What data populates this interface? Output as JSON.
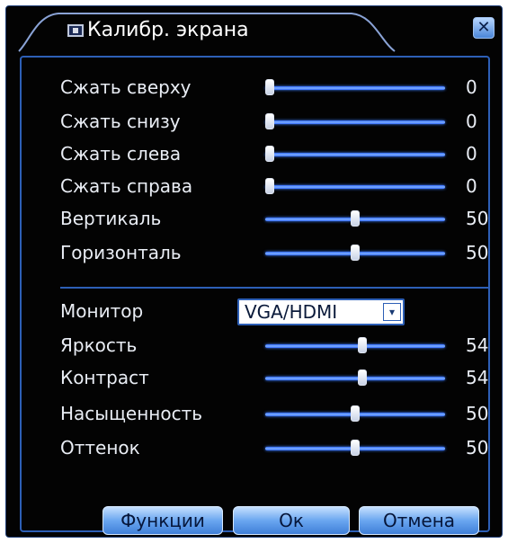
{
  "window": {
    "title": "Калибр. экрана",
    "title_icon": "monitor-icon",
    "close_icon": "close-icon",
    "close_glyph": "✕"
  },
  "geometry_section": {
    "rows": [
      {
        "label": "Сжать сверху",
        "value": "0",
        "level_percent": 0
      },
      {
        "label": "Сжать снизу",
        "value": "0",
        "level_percent": 0
      },
      {
        "label": "Сжать слева",
        "value": "0",
        "level_percent": 0
      },
      {
        "label": "Сжать справа",
        "value": "0",
        "level_percent": 0
      },
      {
        "label": "Вертикаль",
        "value": "50",
        "level_percent": 50
      },
      {
        "label": "Горизонталь",
        "value": "50",
        "level_percent": 50
      }
    ]
  },
  "display_section": {
    "monitor": {
      "label": "Монитор",
      "selected": "VGA/HDMI",
      "arrow_icon": "dropdown-arrow-icon",
      "arrow_glyph": "▾"
    },
    "rows": [
      {
        "label": "Яркость",
        "value": "54",
        "level_percent": 54
      },
      {
        "label": "Контраст",
        "value": "54",
        "level_percent": 54
      },
      {
        "label": "Насыщенность",
        "value": "50",
        "level_percent": 50
      },
      {
        "label": "Оттенок",
        "value": "50",
        "level_percent": 50
      }
    ]
  },
  "buttons": {
    "functions": "Функции",
    "ok": "Ок",
    "cancel": "Отмена"
  },
  "colors": {
    "background": "#030303",
    "border_blue": "#2d5fb6",
    "slider_blue": "#4a86ff",
    "text": "#e9edf4"
  }
}
